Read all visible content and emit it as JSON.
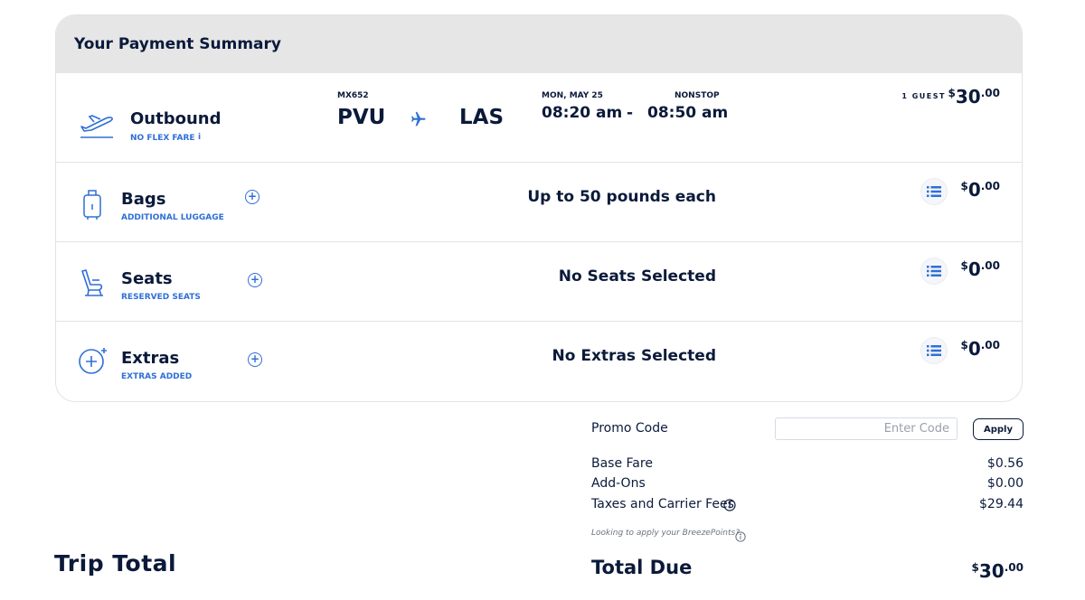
{
  "header": {
    "title": "Your Payment Summary"
  },
  "outbound": {
    "name": "Outbound",
    "fare": "NO FLEX FARE",
    "info": "i",
    "flight": "MX652",
    "from": "PVU",
    "to": "LAS",
    "date": "MON, MAY 25",
    "stops": "NONSTOP",
    "depart": "08:20 am",
    "dash": "-",
    "arrive": "08:50 am",
    "guests": "1 GUEST",
    "price": {
      "cur": "$",
      "dollars": "30",
      "cents": ".00"
    }
  },
  "rows": [
    {
      "name": "Bags",
      "sub": "ADDITIONAL LUGGAGE",
      "summary": "Up to 50 pounds each",
      "price": {
        "cur": "$",
        "dollars": "0",
        "cents": ".00"
      }
    },
    {
      "name": "Seats",
      "sub": "RESERVED SEATS",
      "summary": "No Seats Selected",
      "price": {
        "cur": "$",
        "dollars": "0",
        "cents": ".00"
      }
    },
    {
      "name": "Extras",
      "sub": "EXTRAS ADDED",
      "summary": "No Extras Selected",
      "price": {
        "cur": "$",
        "dollars": "0",
        "cents": ".00"
      }
    }
  ],
  "promo": {
    "label": "Promo Code",
    "placeholder": "Enter Code",
    "apply": "Apply"
  },
  "summary": {
    "base_fare_label": "Base Fare",
    "base_fare": "$0.56",
    "addons_label": "Add-Ons",
    "addons": "$0.00",
    "taxes_label": "Taxes and Carrier Fees",
    "taxes": "$29.44",
    "breeze_note": "Looking to apply your BreezePoints?"
  },
  "trip_total": "Trip Total",
  "total_due": {
    "label": "Total Due",
    "cur": "$",
    "dollars": "30",
    "cents": ".00"
  },
  "colors": {
    "accent": "#2f6fd6",
    "navy": "#0b1a3a",
    "header_bg": "#e6e6e6"
  },
  "icons": [
    "plane-takeoff-icon",
    "plane-icon",
    "luggage-icon",
    "seat-icon",
    "add-extras-icon",
    "plus-circle-icon",
    "list-icon",
    "info-icon"
  ]
}
